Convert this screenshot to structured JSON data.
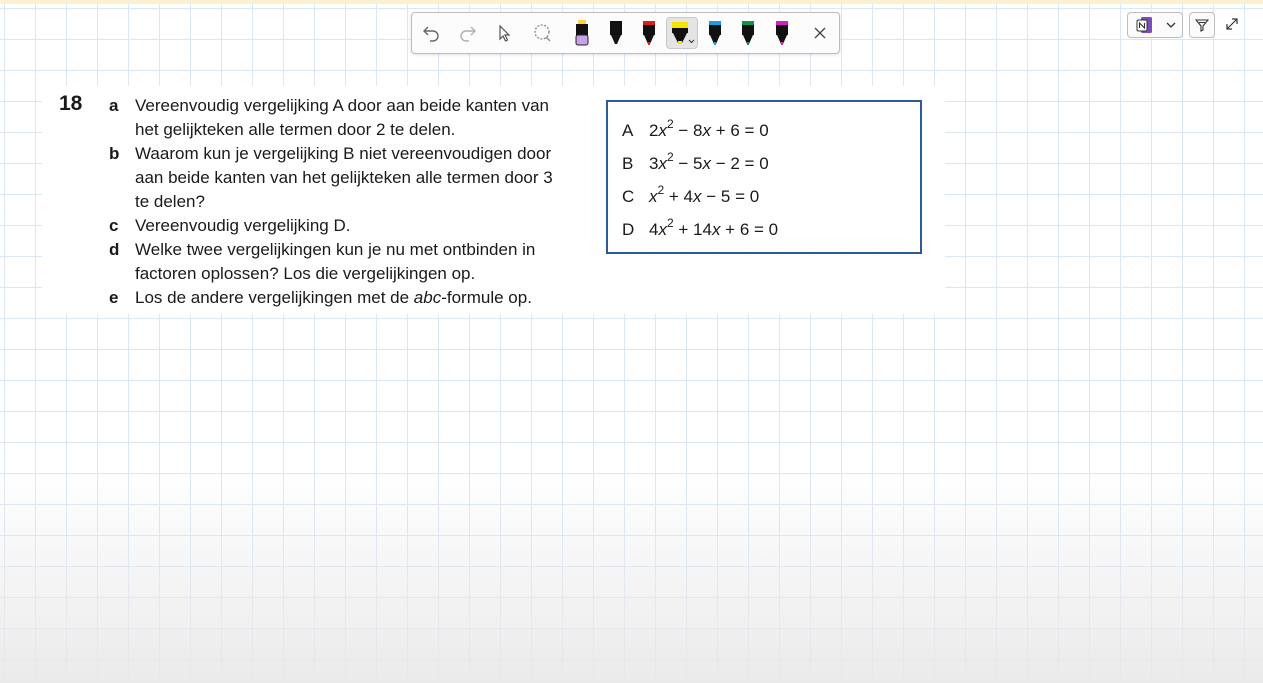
{
  "toolbar": {
    "tools": [
      {
        "name": "undo-icon"
      },
      {
        "name": "redo-icon"
      },
      {
        "name": "select-pointer-icon"
      },
      {
        "name": "lasso-icon"
      },
      {
        "name": "pen-lavender-icon",
        "color": "#c8a2e8"
      },
      {
        "name": "pen-black-icon",
        "color": "#111111"
      },
      {
        "name": "pen-red-icon",
        "color": "#d42020"
      },
      {
        "name": "highlighter-yellow-icon",
        "color": "#f5e600",
        "selected": true
      },
      {
        "name": "pen-blue-icon",
        "color": "#1f9be0"
      },
      {
        "name": "pen-green-icon",
        "color": "#14914a"
      },
      {
        "name": "pen-magenta-icon",
        "color": "#d41fbf"
      },
      {
        "name": "close-icon"
      }
    ]
  },
  "controls": {
    "app_icon": "onenote-icon",
    "dropdown": "chevron-down-icon",
    "filter": "filter-icon",
    "expand": "expand-icon"
  },
  "exercise": {
    "number": "18",
    "items": [
      {
        "letter": "a",
        "lines": [
          "Vereenvoudig vergelijking A door aan beide kanten van",
          "het gelijkteken alle termen door 2 te delen."
        ]
      },
      {
        "letter": "b",
        "lines": [
          "Waarom kun je vergelijking B niet vereenvoudigen door",
          "aan beide kanten van het gelijkteken alle termen door 3",
          "te delen?"
        ]
      },
      {
        "letter": "c",
        "lines": [
          "Vereenvoudig vergelijking D."
        ]
      },
      {
        "letter": "d",
        "lines": [
          "Welke twee vergelijkingen kun je nu met ontbinden in",
          "factoren oplossen? Los die vergelijkingen op."
        ]
      },
      {
        "letter": "e",
        "lines": [
          "Los de andere vergelijkingen met de ",
          "abc",
          "-formule op."
        ]
      }
    ]
  },
  "equations": [
    {
      "label": "A",
      "coef": "2",
      "var": "x",
      "exp": "2",
      "rest1": " − 8",
      "var2": "x",
      "rest2": " + 6 = 0"
    },
    {
      "label": "B",
      "coef": "3",
      "var": "x",
      "exp": "2",
      "rest1": " − 5",
      "var2": "x",
      "rest2": " − 2 = 0"
    },
    {
      "label": "C",
      "coef": "",
      "var": "x",
      "exp": "2",
      "rest1": " + 4",
      "var2": "x",
      "rest2": " − 5 = 0"
    },
    {
      "label": "D",
      "coef": "4",
      "var": "x",
      "exp": "2",
      "rest1": " + 14",
      "var2": "x",
      "rest2": " + 6 = 0"
    }
  ],
  "colors": {
    "box_border": "#2a5d96",
    "grid": "#dbe7f4"
  }
}
